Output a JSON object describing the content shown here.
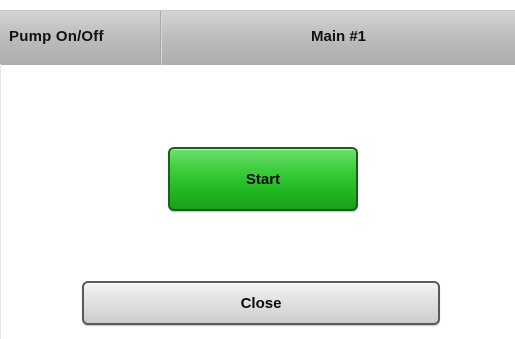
{
  "header": {
    "title": "Pump On/Off",
    "target": "Main #1"
  },
  "actions": {
    "start_label": "Start",
    "close_label": "Close"
  },
  "colors": {
    "start_button": "#2ec42e",
    "header_background": "#bcbcbc",
    "close_button": "#e2e2e2"
  }
}
